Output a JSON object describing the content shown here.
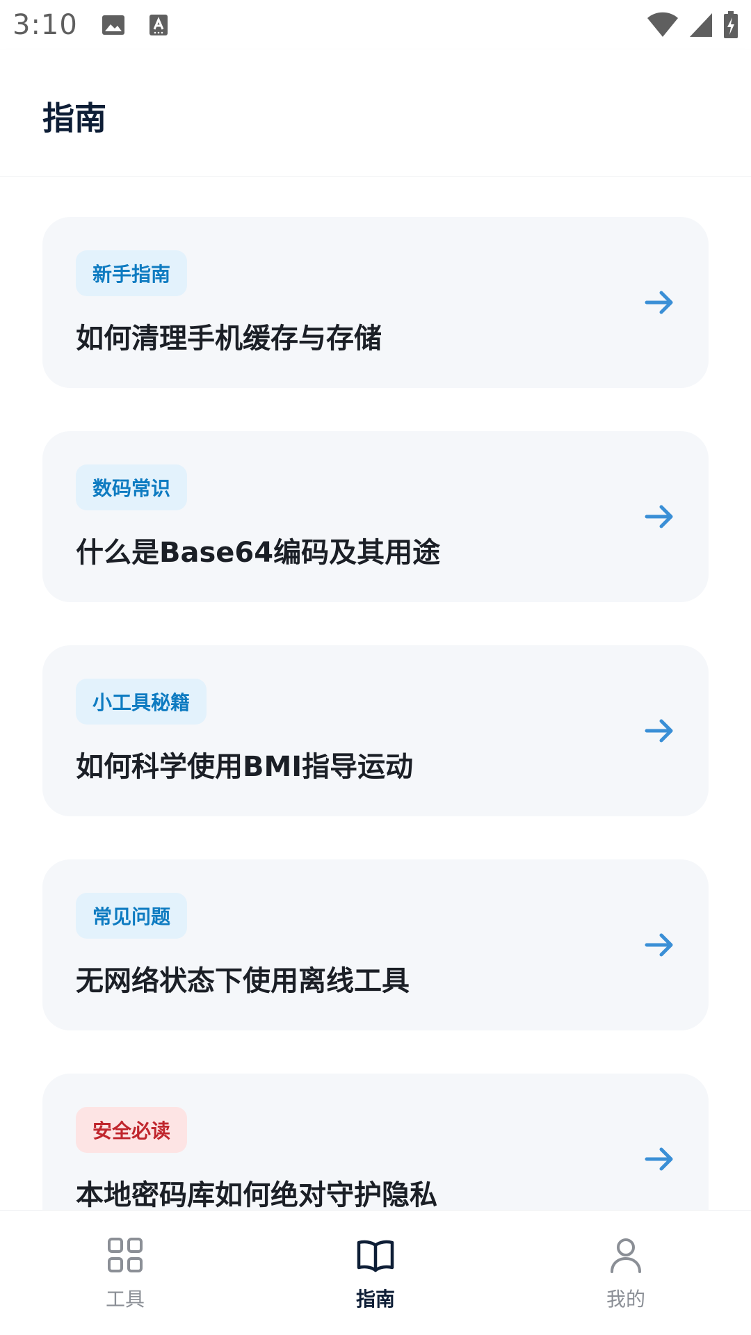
{
  "status_bar": {
    "time": "3:10"
  },
  "header": {
    "title": "指南"
  },
  "guides": [
    {
      "tag": "新手指南",
      "title": "如何清理手机缓存与存储",
      "tag_color": "blue"
    },
    {
      "tag": "数码常识",
      "title": "什么是Base64编码及其用途",
      "tag_color": "blue"
    },
    {
      "tag": "小工具秘籍",
      "title": "如何科学使用BMI指导运动",
      "tag_color": "blue"
    },
    {
      "tag": "常见问题",
      "title": "无网络状态下使用离线工具",
      "tag_color": "blue"
    },
    {
      "tag": "安全必读",
      "title": "本地密码库如何绝对守护隐私",
      "tag_color": "red"
    }
  ],
  "nav": {
    "items": [
      {
        "label": "工具",
        "icon": "grid-icon"
      },
      {
        "label": "指南",
        "icon": "book-icon"
      },
      {
        "label": "我的",
        "icon": "person-icon"
      }
    ],
    "active_index": 1
  },
  "colors": {
    "accent": "#0e7bc1",
    "arrow": "#3a8fd6",
    "title_dark": "#0e1e36",
    "card_bg": "#f5f7fa",
    "tag_blue_bg": "#e3f2fc",
    "tag_red_bg": "#fde4e4",
    "tag_red_text": "#c0262d"
  }
}
